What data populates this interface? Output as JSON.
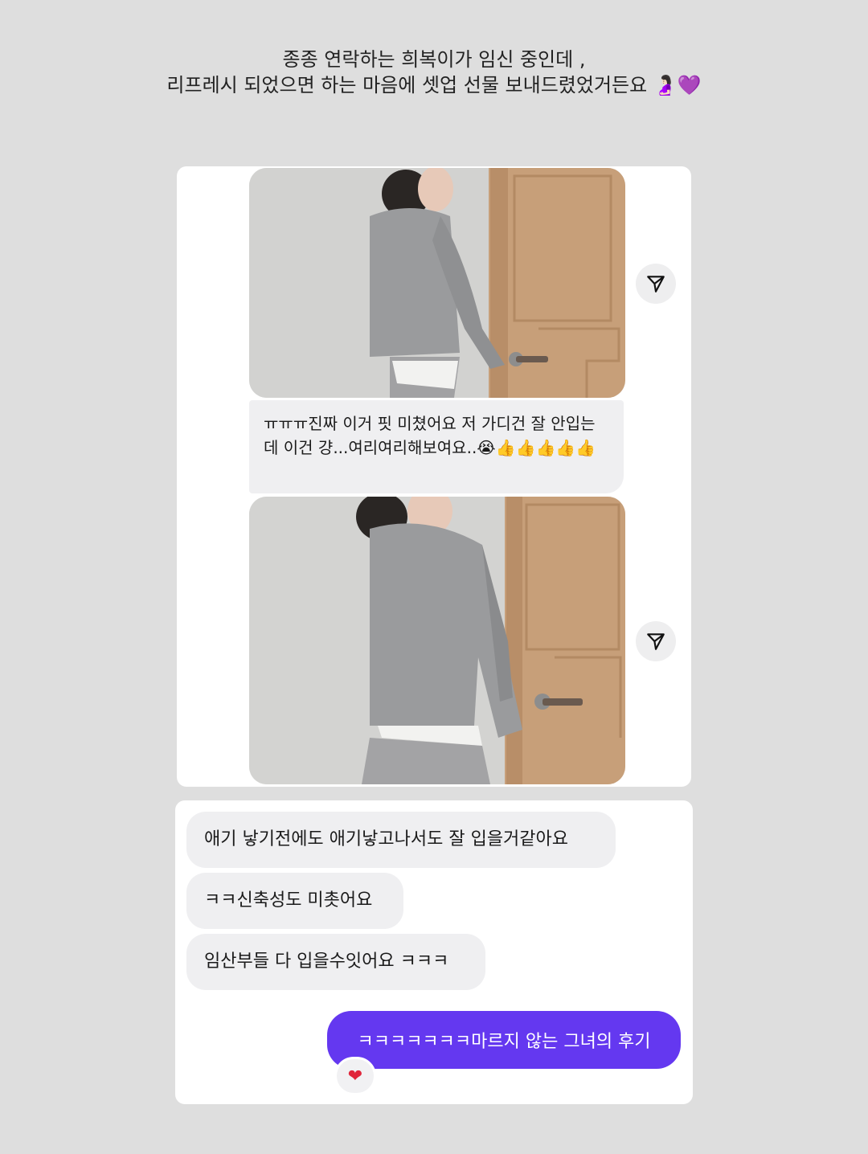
{
  "caption": {
    "line1": "종종 연락하는 희복이가 임신 중인데 ,",
    "line2": "리프레시 되었으면 하는 마음에 셋업 선물 보내드렸었거든요 🤰🏻💜"
  },
  "chat1": {
    "photo1": {
      "icon": "photo-woman-grey-cardigan-side"
    },
    "share_icon": "share-send-icon",
    "message": "ㅠㅠㅠ진짜 이거 핏 미쳤어요 저 가디건 잘 안입는데 이건 걍...여리여리해보여요..😭👍👍👍👍👍",
    "photo2": {
      "icon": "photo-woman-grey-cardigan-back"
    }
  },
  "chat2": {
    "messages": [
      "애기 낳기전에도 애기낳고나서도 잘 입을거같아요",
      "ㅋㅋ신축성도 미촛어요",
      "임산부들 다 입을수잇어요 ㅋㅋㅋ"
    ],
    "reply": "ㅋㅋㅋㅋㅋㅋㅋ마르지 않는 그녀의 후기",
    "reaction": "❤"
  },
  "colors": {
    "background": "#dedede",
    "bubble_in": "#efeff1",
    "bubble_out": "#6438f0"
  }
}
